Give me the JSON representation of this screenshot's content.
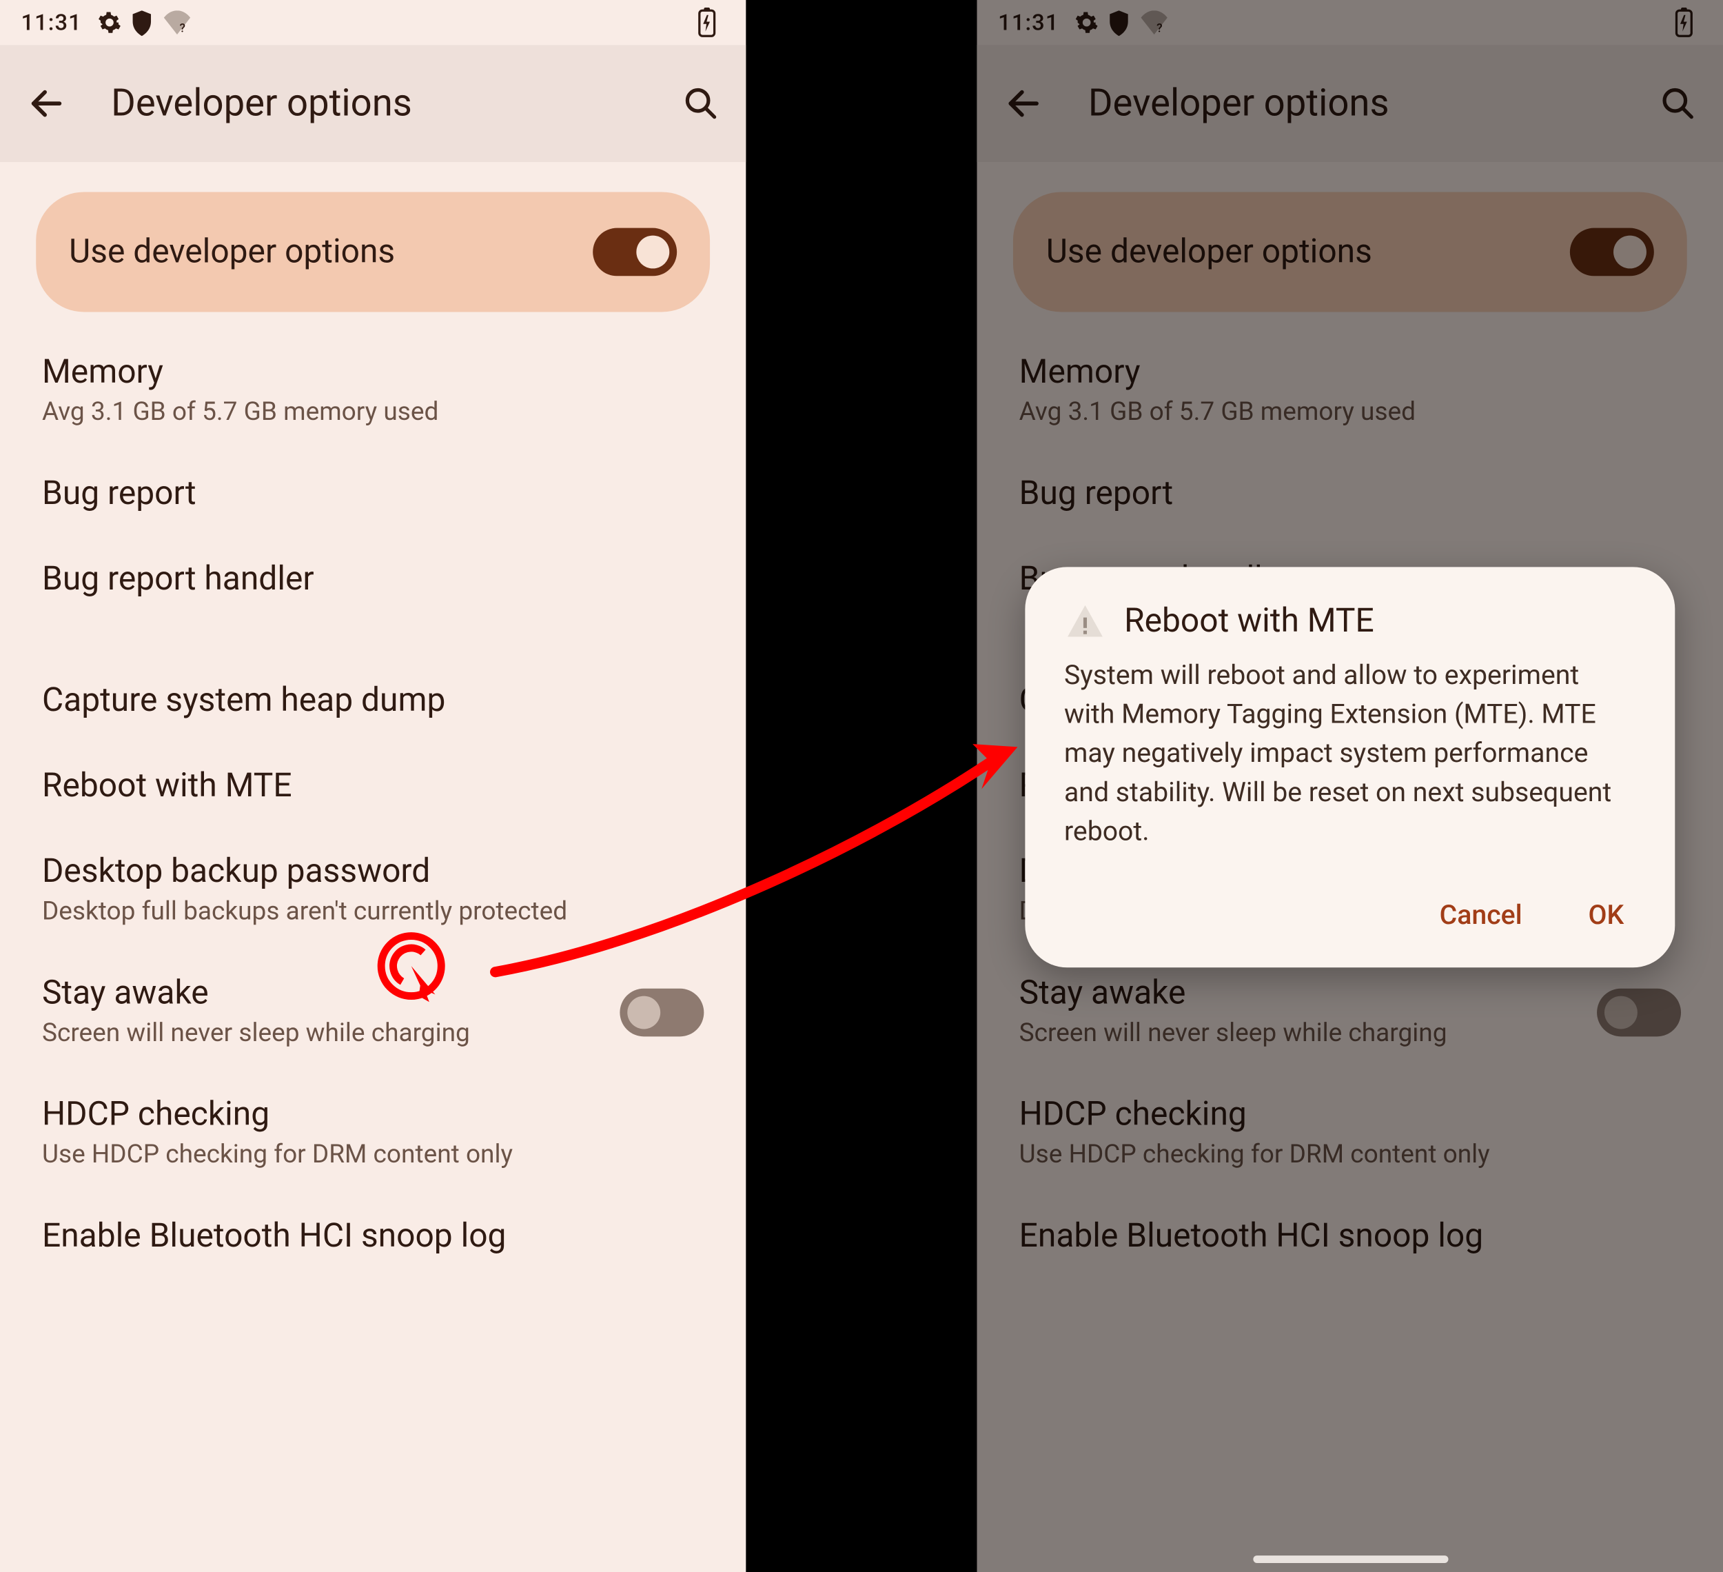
{
  "status": {
    "time": "11:31"
  },
  "appbar": {
    "title": "Developer options"
  },
  "useDev": {
    "label": "Use developer options"
  },
  "items": {
    "memory": {
      "title": "Memory",
      "sub": "Avg 3.1 GB of 5.7 GB memory used"
    },
    "bugReport": {
      "title": "Bug report"
    },
    "bugHandler": {
      "title": "Bug report handler"
    },
    "heapDump": {
      "title": "Capture system heap dump"
    },
    "rebootMte": {
      "title": "Reboot with MTE"
    },
    "desktopBackup": {
      "title": "Desktop backup password",
      "sub": "Desktop full backups aren't currently protected"
    },
    "stayAwake": {
      "title": "Stay awake",
      "sub": "Screen will never sleep while charging"
    },
    "hdcp": {
      "title": "HDCP checking",
      "sub": "Use HDCP checking for DRM content only"
    },
    "btSnoop": {
      "title": "Enable Bluetooth HCI snoop log"
    }
  },
  "dialog": {
    "title": "Reboot with MTE",
    "body": "System will reboot and allow to experiment with Memory Tagging Extension (MTE). MTE may negatively impact system performance and stability. Will be reset on next subsequent reboot.",
    "cancel": "Cancel",
    "ok": "OK"
  }
}
